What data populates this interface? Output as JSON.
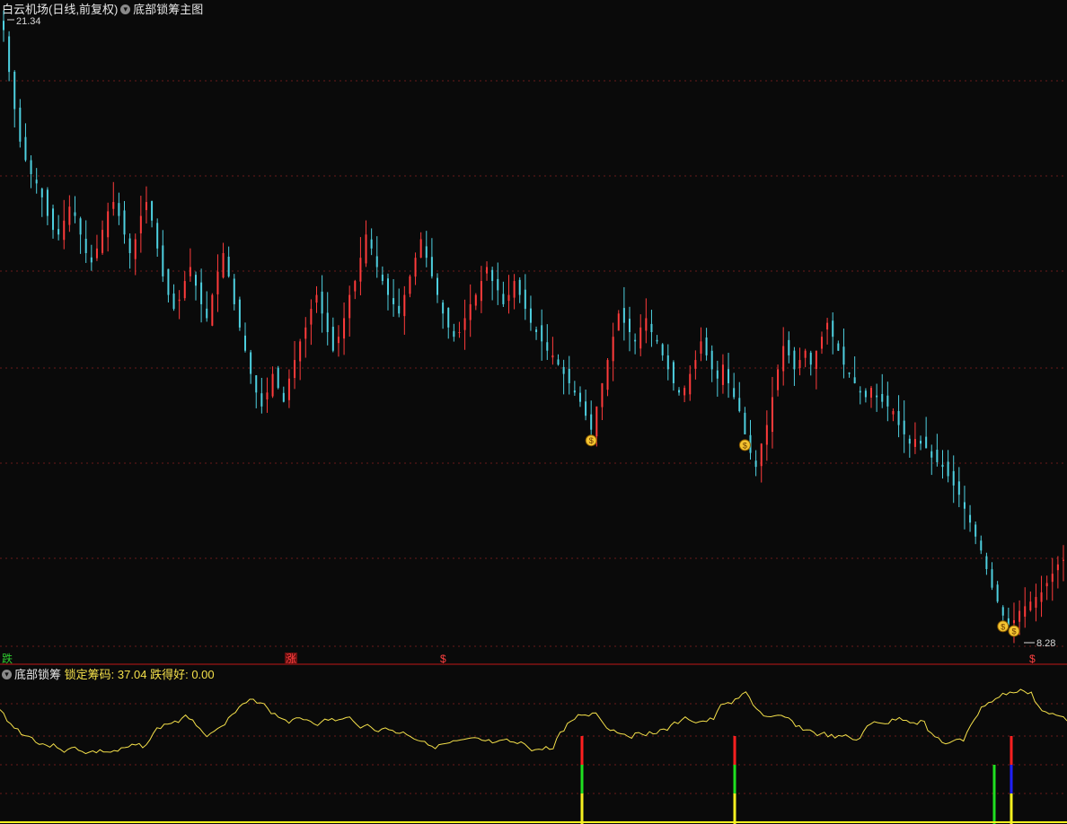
{
  "header_main": {
    "stock_name": "白云机场",
    "mode": "(日线,前复权)",
    "indicator": "底部锁筹主图"
  },
  "header_sub": {
    "indicator": "底部锁筹",
    "lock_label": "锁定筹码:",
    "lock_value": "37.04",
    "good_label": "跌得好:",
    "good_value": "0.00"
  },
  "signals_bottom": [
    "跌",
    "涨",
    "$",
    "$"
  ],
  "colors": {
    "up": "#ff3b3b",
    "down": "#4ed0e0",
    "line": "#f4e04a",
    "grid": "#6a1a1a",
    "divider": "#c01818",
    "bar_red": "#ff2020",
    "bar_green": "#20e020",
    "bar_blue": "#2020ff",
    "bar_yellow": "#f4f020"
  },
  "chart_data": [
    {
      "type": "candlestick",
      "title": "白云机场 (日线,前复权) 底部锁筹主图",
      "ylim": [
        8.0,
        21.6
      ],
      "price_labels": {
        "high": "21.34",
        "low": "8.28"
      },
      "series_close": [
        21.3,
        20.4,
        19.6,
        18.9,
        18.5,
        18.2,
        18.0,
        17.7,
        17.3,
        17.0,
        16.9,
        17.2,
        17.5,
        17.3,
        16.9,
        16.5,
        16.3,
        16.6,
        17.0,
        17.4,
        17.6,
        17.3,
        16.9,
        16.5,
        16.8,
        17.3,
        17.6,
        17.2,
        16.6,
        16.0,
        15.6,
        15.3,
        15.5,
        15.9,
        16.2,
        15.8,
        15.4,
        15.1,
        15.6,
        16.1,
        16.5,
        16.0,
        15.4,
        14.9,
        14.4,
        13.9,
        13.5,
        13.2,
        13.5,
        13.9,
        13.6,
        13.3,
        13.8,
        14.2,
        14.6,
        14.9,
        15.3,
        15.6,
        15.2,
        14.8,
        14.4,
        14.7,
        15.1,
        15.6,
        15.9,
        16.4,
        16.9,
        16.6,
        16.2,
        15.9,
        15.6,
        15.4,
        15.2,
        15.6,
        16.0,
        16.4,
        16.8,
        16.4,
        16.0,
        15.6,
        15.2,
        14.9,
        14.7,
        14.8,
        15.1,
        15.4,
        15.6,
        15.9,
        16.2,
        15.9,
        15.7,
        15.4,
        15.6,
        15.9,
        15.6,
        15.3,
        15.0,
        14.8,
        14.6,
        14.4,
        14.3,
        14.1,
        13.9,
        13.7,
        13.5,
        13.3,
        13.0,
        12.7,
        13.2,
        13.7,
        14.2,
        14.7,
        15.2,
        15.0,
        14.8,
        14.6,
        14.9,
        15.1,
        14.8,
        14.6,
        14.3,
        14.0,
        13.7,
        13.5,
        13.6,
        13.9,
        14.2,
        14.6,
        14.3,
        14.0,
        13.8,
        14.1,
        13.7,
        13.4,
        13.1,
        12.6,
        12.2,
        11.9,
        12.4,
        12.8,
        13.4,
        14.0,
        14.5,
        14.3,
        14.0,
        14.2,
        14.4,
        14.1,
        14.4,
        14.7,
        15.0,
        14.7,
        14.4,
        14.1,
        13.9,
        13.7,
        13.5,
        13.4,
        13.6,
        13.4,
        13.3,
        13.2,
        13.1,
        12.8,
        12.6,
        12.4,
        12.5,
        12.4,
        12.3,
        12.1,
        12.0,
        11.9,
        11.7,
        11.5,
        11.3,
        11.0,
        10.7,
        10.4,
        10.1,
        9.7,
        9.3,
        9.0,
        8.7,
        8.5,
        8.6,
        8.8,
        8.9,
        9.0,
        9.1,
        9.2,
        9.4,
        9.6,
        9.8,
        9.9
      ]
    },
    {
      "type": "line",
      "title": "底部锁筹",
      "series": [
        {
          "name": "锁定筹码",
          "values": [
            37.04
          ]
        },
        {
          "name": "跌得好",
          "values": [
            0.0
          ]
        }
      ]
    }
  ]
}
